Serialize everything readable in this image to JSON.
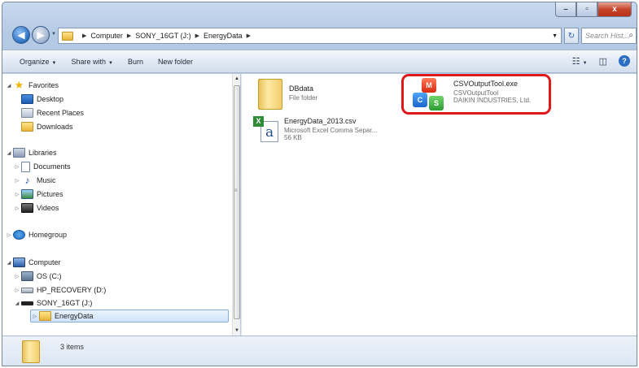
{
  "window": {
    "caption_buttons": [
      "–",
      "▫",
      "x"
    ]
  },
  "address": {
    "crumbs": [
      "Computer",
      "SONY_16GT (J:)",
      "EnergyData"
    ],
    "search_placeholder": "Search Hist...",
    "refresh_glyph": "↻"
  },
  "toolbar": {
    "organize": "Organize",
    "share_with": "Share with",
    "burn": "Burn",
    "new_folder": "New folder",
    "dropdown_glyph": "▼",
    "views_glyph": "☷",
    "preview_glyph": "◫",
    "help_glyph": "?"
  },
  "nav": {
    "favorites": "Favorites",
    "desktop": "Desktop",
    "recent_places": "Recent Places",
    "downloads": "Downloads",
    "libraries": "Libraries",
    "documents": "Documents",
    "music": "Music",
    "pictures": "Pictures",
    "videos": "Videos",
    "homegroup": "Homegroup",
    "computer": "Computer",
    "os_drive": "OS (C:)",
    "recovery_drive": "HP_RECOVERY (D:)",
    "usb_drive": "SONY_16GT (J:)",
    "energy_data": "EnergyData",
    "arrow_expanded": "◢",
    "arrow_collapsed": "▷"
  },
  "files": [
    {
      "name": "DBdata",
      "line2": "File folder",
      "line3": ""
    },
    {
      "name": "EnergyData_2013.csv",
      "line2": "Microsoft Excel Comma Separ...",
      "line3": "56 KB"
    },
    {
      "name": "CSVOutputTool.exe",
      "line2": "CSVOutputTool",
      "line3": "DAIKIN INDUSTRIES, Ltd."
    }
  ],
  "status": {
    "item_count": "3 items"
  },
  "colors": {
    "highlight": "#e0191b"
  }
}
